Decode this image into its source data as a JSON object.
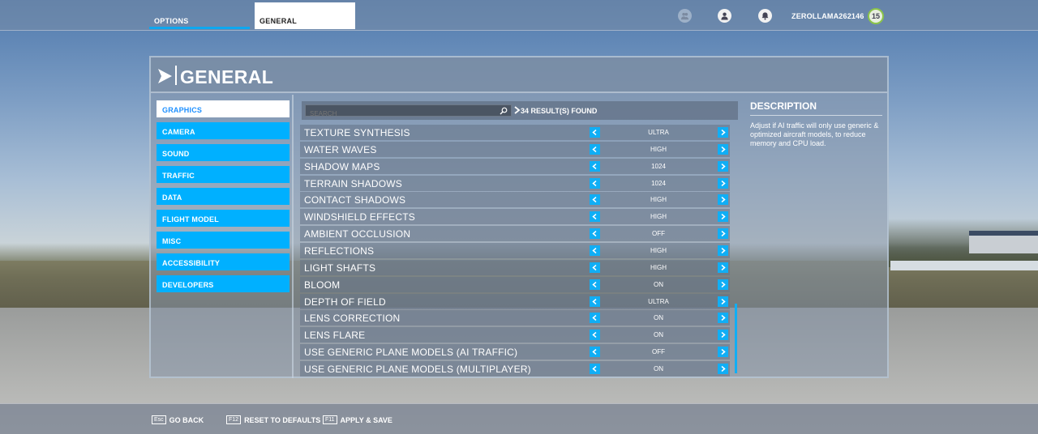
{
  "topbar": {
    "tabs": [
      {
        "label": "OPTIONS"
      },
      {
        "label": "GENERAL"
      }
    ],
    "username": "ZEROLLAMA262146",
    "level": "15"
  },
  "panel": {
    "title": "GENERAL",
    "categories": [
      {
        "label": "GRAPHICS"
      },
      {
        "label": "CAMERA"
      },
      {
        "label": "SOUND"
      },
      {
        "label": "TRAFFIC"
      },
      {
        "label": "DATA"
      },
      {
        "label": "FLIGHT MODEL"
      },
      {
        "label": "MISC"
      },
      {
        "label": "ACCESSIBILITY"
      },
      {
        "label": "DEVELOPERS"
      }
    ],
    "search": {
      "placeholder": "SEARCH",
      "value": ""
    },
    "results": "34 RESULT(S) FOUND",
    "settings": [
      {
        "label": "TEXTURE SYNTHESIS",
        "value": "ULTRA"
      },
      {
        "label": "WATER WAVES",
        "value": "HIGH"
      },
      {
        "label": "SHADOW MAPS",
        "value": "1024"
      },
      {
        "label": "TERRAIN SHADOWS",
        "value": "1024"
      },
      {
        "label": "CONTACT SHADOWS",
        "value": "HIGH"
      },
      {
        "label": "WINDSHIELD EFFECTS",
        "value": "HIGH"
      },
      {
        "label": "AMBIENT OCCLUSION",
        "value": "OFF"
      },
      {
        "label": "REFLECTIONS",
        "value": "HIGH"
      },
      {
        "label": "LIGHT SHAFTS",
        "value": "HIGH"
      },
      {
        "label": "BLOOM",
        "value": "ON"
      },
      {
        "label": "DEPTH OF FIELD",
        "value": "ULTRA"
      },
      {
        "label": "LENS CORRECTION",
        "value": "ON"
      },
      {
        "label": "LENS FLARE",
        "value": "ON"
      },
      {
        "label": "USE GENERIC PLANE MODELS (AI TRAFFIC)",
        "value": "OFF"
      },
      {
        "label": "USE GENERIC PLANE MODELS (MULTIPLAYER)",
        "value": "ON"
      }
    ],
    "description": {
      "title": "DESCRIPTION",
      "text": "Adjust if AI traffic will only use generic & optimized aircraft models, to reduce memory and CPU load."
    }
  },
  "bottombar": {
    "go_back": {
      "key": "Esc",
      "label": "GO BACK"
    },
    "reset": {
      "key": "F12",
      "label": "RESET TO DEFAULTS"
    },
    "apply": {
      "key": "F11",
      "label": "APPLY & SAVE"
    }
  },
  "colors": {
    "accent": "#00b0ff",
    "active_tab_text": "#1e90ff"
  }
}
